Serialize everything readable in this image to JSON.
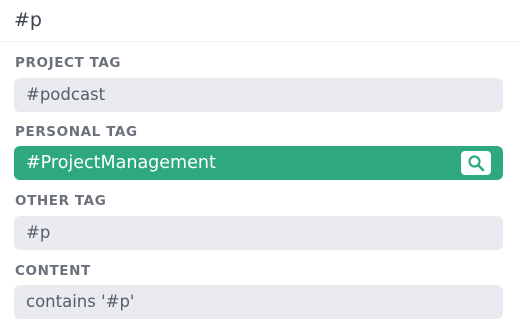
{
  "search": {
    "query": "#p"
  },
  "sections": [
    {
      "label": "PROJECT TAG",
      "item": "#podcast"
    },
    {
      "label": "PERSONAL TAG",
      "item": "#ProjectManagement",
      "selected": true
    },
    {
      "label": "OTHER TAG",
      "item": "#p"
    },
    {
      "label": "CONTENT",
      "item": "contains '#p'"
    }
  ],
  "icons": {
    "selected_action": "search-icon"
  },
  "colors": {
    "accent": "#2ea87e",
    "item_background": "#e9ebf0",
    "label_text": "#6b717b",
    "item_text": "#575e68"
  }
}
